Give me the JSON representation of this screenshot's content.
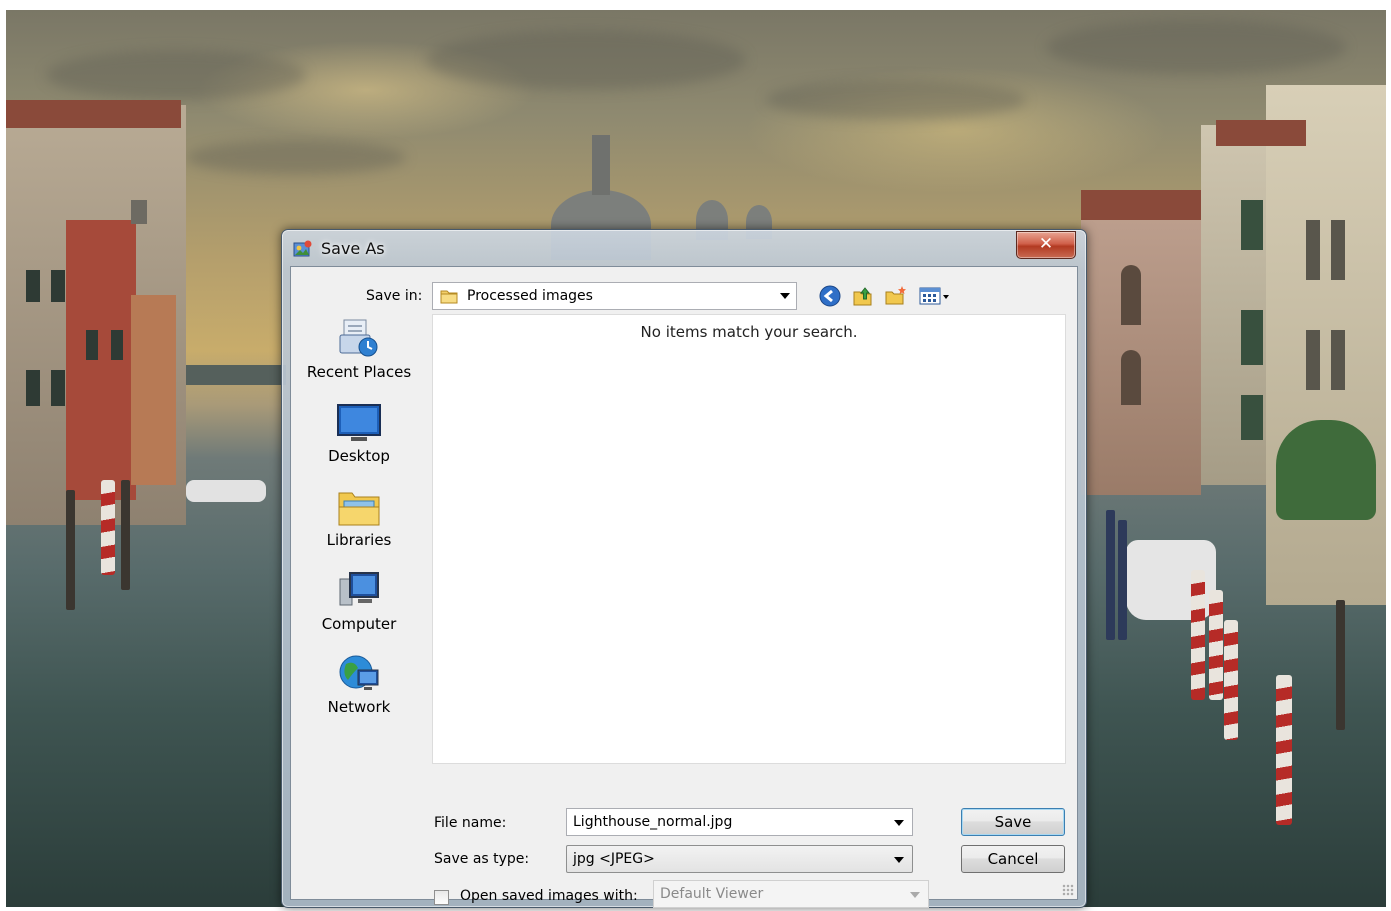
{
  "dialog": {
    "title": "Save As",
    "close_label": "✕",
    "save_in_label": "Save in:",
    "save_in_value": "Processed images",
    "empty_message": "No items match your search.",
    "places": [
      {
        "label": "Recent Places",
        "icon": "recent-places-icon"
      },
      {
        "label": "Desktop",
        "icon": "desktop-icon"
      },
      {
        "label": "Libraries",
        "icon": "libraries-icon"
      },
      {
        "label": "Computer",
        "icon": "computer-icon"
      },
      {
        "label": "Network",
        "icon": "network-icon"
      }
    ],
    "toolbar_icons": [
      "back-icon",
      "up-folder-icon",
      "new-folder-icon",
      "view-menu-icon"
    ],
    "file_name_label": "File name:",
    "file_name_value": "Lighthouse_normal.jpg",
    "save_type_label": "Save as type:",
    "save_type_value": "jpg <JPEG>",
    "open_with_label": "Open saved images with:",
    "open_with_checked": false,
    "open_with_value": "Default Viewer",
    "save_button": "Save",
    "cancel_button": "Cancel"
  },
  "colors": {
    "close_button": "#c8503a",
    "accent_blue": "#3c7fb1"
  }
}
